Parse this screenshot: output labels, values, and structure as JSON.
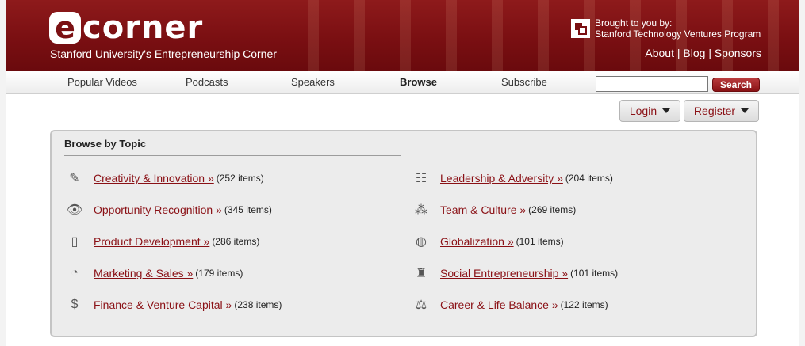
{
  "header": {
    "logo_e": "e",
    "logo_rest": "corner",
    "tagline": "Stanford University's Entrepreneurship Corner",
    "stvp_line1": "Brought to you by:",
    "stvp_line2": "Stanford Technology Ventures Program",
    "links": [
      "About",
      "Blog",
      "Sponsors"
    ]
  },
  "nav": {
    "items": [
      "Popular Videos",
      "Podcasts",
      "Speakers",
      "Browse",
      "Subscribe"
    ],
    "active": "Browse",
    "search_value": "",
    "search_label": "Search"
  },
  "account": {
    "login": "Login",
    "register": "Register"
  },
  "browse": {
    "title": "Browse by Topic",
    "left": [
      {
        "label": "Creativity & Innovation »",
        "count": "(252 items)",
        "icon": "lightbulb-icon"
      },
      {
        "label": "Opportunity Recognition »",
        "count": "(345 items)",
        "icon": "eye-icon"
      },
      {
        "label": "Product Development »",
        "count": "(286 items)",
        "icon": "device-icon"
      },
      {
        "label": "Marketing & Sales »",
        "count": "(179 items)",
        "icon": "chart-icon"
      },
      {
        "label": "Finance & Venture Capital »",
        "count": "(238 items)",
        "icon": "money-bag-icon"
      }
    ],
    "right": [
      {
        "label": "Leadership & Adversity »",
        "count": "(204 items)",
        "icon": "people-group-icon"
      },
      {
        "label": "Team & Culture »",
        "count": "(269 items)",
        "icon": "team-icon"
      },
      {
        "label": "Globalization »",
        "count": "(101 items)",
        "icon": "globe-icon"
      },
      {
        "label": "Social Entrepreneurship »",
        "count": "(101 items)",
        "icon": "person-icon"
      },
      {
        "label": "Career & Life Balance »",
        "count": "(122 items)",
        "icon": "scale-icon"
      }
    ]
  },
  "colors": {
    "brand": "#7b1013",
    "link": "#8a1015",
    "panel_bg": "#ececec"
  }
}
